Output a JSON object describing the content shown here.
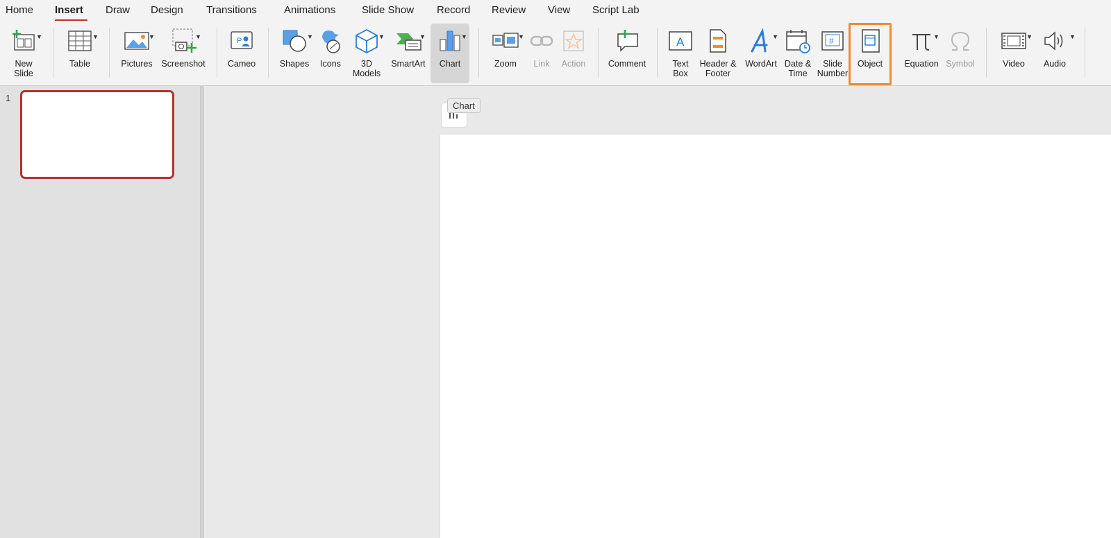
{
  "menu": {
    "tabs": [
      {
        "label": "Home"
      },
      {
        "label": "Insert"
      },
      {
        "label": "Draw"
      },
      {
        "label": "Design"
      },
      {
        "label": "Transitions"
      },
      {
        "label": "Animations"
      },
      {
        "label": "Slide Show"
      },
      {
        "label": "Record"
      },
      {
        "label": "Review"
      },
      {
        "label": "View"
      },
      {
        "label": "Script Lab"
      }
    ],
    "active_tab": "Insert"
  },
  "ribbon": {
    "buttons": {
      "new_slide": "New\nSlide",
      "table": "Table",
      "pictures": "Pictures",
      "screenshot": "Screenshot",
      "cameo": "Cameo",
      "shapes": "Shapes",
      "icons": "Icons",
      "models_3d": "3D\nModels",
      "smartart": "SmartArt",
      "chart": "Chart",
      "zoom": "Zoom",
      "link": "Link",
      "action": "Action",
      "comment": "Comment",
      "text_box": "Text\nBox",
      "header_footer": "Header &\nFooter",
      "wordart": "WordArt",
      "date_time": "Date &\nTime",
      "slide_number": "Slide\nNumber",
      "object": "Object",
      "equation": "Equation",
      "symbol": "Symbol",
      "video": "Video",
      "audio": "Audio"
    }
  },
  "slides_pane": {
    "slides": [
      {
        "number": "1"
      }
    ]
  },
  "tooltip": {
    "text": "Chart"
  },
  "colors": {
    "accent_red": "#c0312a",
    "highlight_orange": "#f08a33",
    "icon_blue": "#2b7cd3"
  }
}
